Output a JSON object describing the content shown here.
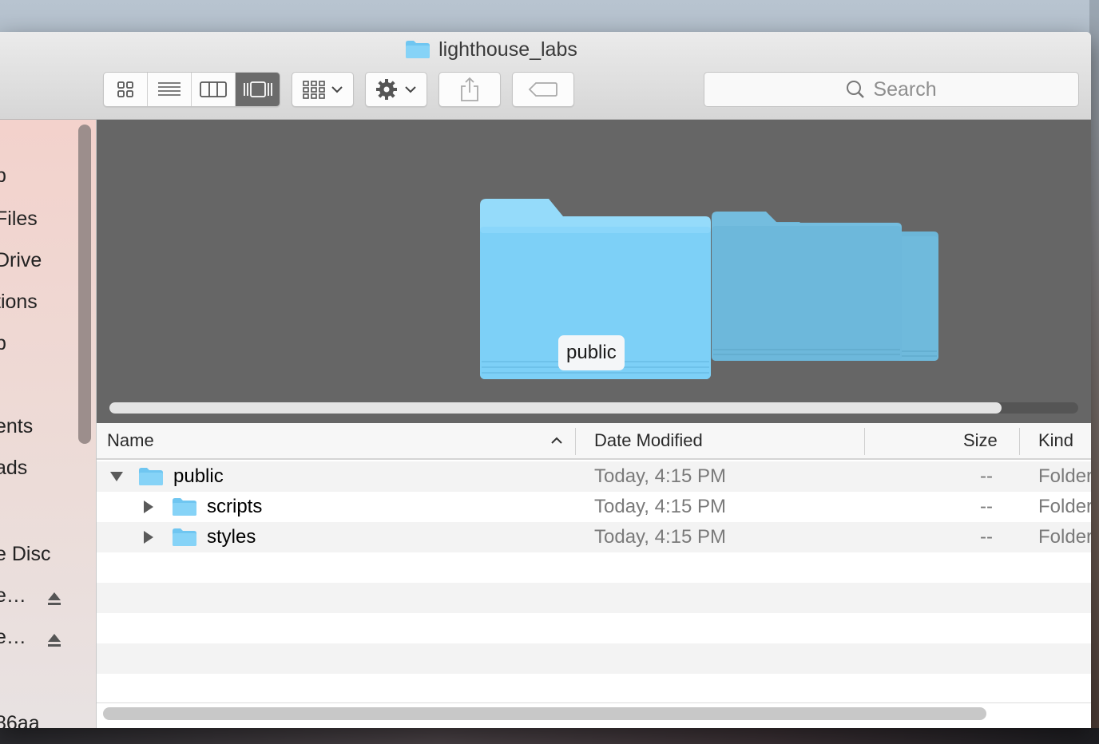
{
  "window": {
    "title": "lighthouse_labs"
  },
  "toolbar": {
    "view_buttons": [
      "icon-view",
      "list-view",
      "column-view",
      "cover-flow-view"
    ],
    "active_view": "cover-flow-view",
    "arrange_button": "arrange-icon",
    "action_button": "gear-icon",
    "share_button": "share-icon",
    "tag_button": "tag-icon",
    "search_placeholder": "Search"
  },
  "sidebar": {
    "items": [
      "p",
      "Files",
      "Drive",
      "tions",
      "p",
      "ents",
      "ads",
      "e Disc",
      "e…",
      "e…",
      "86aa"
    ]
  },
  "preview": {
    "selected_label": "public"
  },
  "list": {
    "headers": {
      "name": "Name",
      "date": "Date Modified",
      "size": "Size",
      "kind": "Kind"
    },
    "rows": [
      {
        "name": "public",
        "date": "Today, 4:15 PM",
        "size": "--",
        "kind": "Folder",
        "expanded": true,
        "indent": 0
      },
      {
        "name": "scripts",
        "date": "Today, 4:15 PM",
        "size": "--",
        "kind": "Folder",
        "expanded": false,
        "indent": 1
      },
      {
        "name": "styles",
        "date": "Today, 4:15 PM",
        "size": "--",
        "kind": "Folder",
        "expanded": false,
        "indent": 1
      }
    ]
  },
  "colors": {
    "folder_blue": "#7ccff5",
    "preview_bg": "#666666",
    "active_view_bg": "#6b6b6b"
  }
}
